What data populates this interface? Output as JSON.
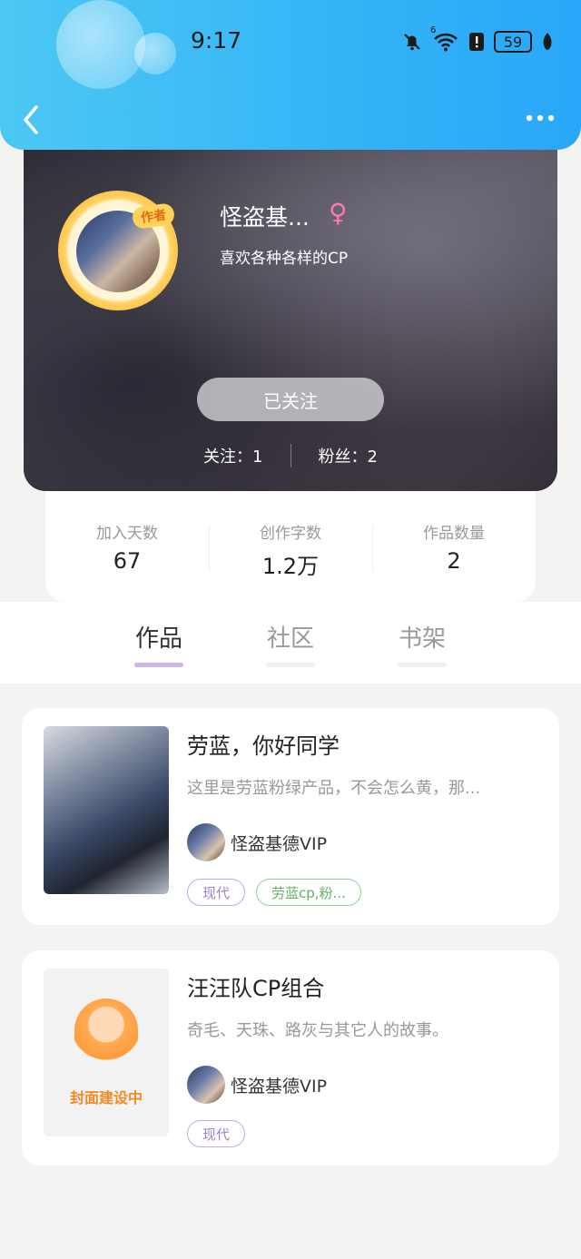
{
  "status_bar": {
    "time": "9:17",
    "network": "6",
    "battery": "59",
    "icons": [
      "bell-muted-icon",
      "wifi-icon",
      "alert-icon",
      "battery-icon",
      "leaf-icon"
    ]
  },
  "header": {
    "back_icon": "chevron-left-icon",
    "more_icon": "more-dots-icon"
  },
  "profile": {
    "badge": "作者",
    "nickname": "怪盗基...",
    "gender_symbol": "♀",
    "bio": "喜欢各种各样的CP",
    "follow_button": "已关注",
    "following_label": "关注：1",
    "followers_label": "粉丝：2"
  },
  "stats": [
    {
      "label": "加入天数",
      "value": "67"
    },
    {
      "label": "创作字数",
      "value": "1.2万"
    },
    {
      "label": "作品数量",
      "value": "2"
    }
  ],
  "tabs": [
    {
      "label": "作品",
      "active": true
    },
    {
      "label": "社区",
      "active": false
    },
    {
      "label": "书架",
      "active": false
    }
  ],
  "books": [
    {
      "title": "劳蓝，你好同学",
      "description": "这里是劳蓝粉绿产品，不会怎么黄，那...",
      "author": "怪盗基德VIP",
      "tags": [
        "现代",
        "劳蓝cp,粉..."
      ]
    },
    {
      "title": "汪汪队CP组合",
      "description": "奇毛、天珠、路灰与其它人的故事。",
      "author": "怪盗基德VIP",
      "cover_text": "封面建设中",
      "tags": [
        "现代"
      ]
    }
  ],
  "colors": {
    "header_blue": "#33b4f6",
    "tab_indicator": "#cdb4ec",
    "tag_purple": "#a27fcf",
    "tag_green": "#5fae63"
  }
}
